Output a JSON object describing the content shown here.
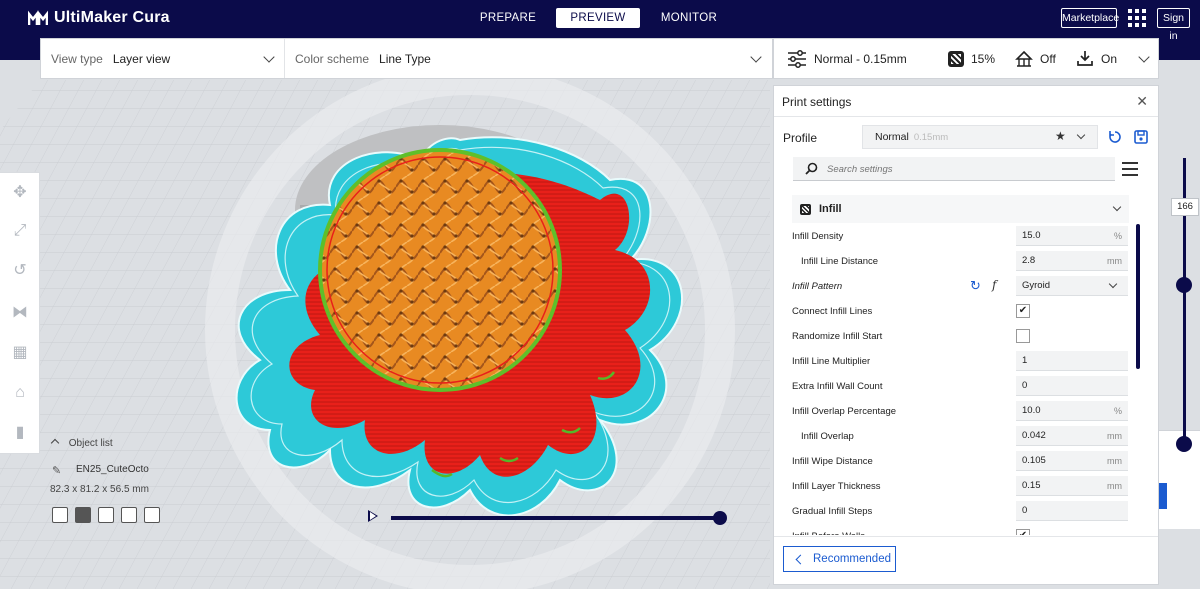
{
  "app": {
    "title": "UltiMaker Cura"
  },
  "stages": [
    {
      "label": "PREPARE",
      "active": false
    },
    {
      "label": "PREVIEW",
      "active": true
    },
    {
      "label": "MONITOR",
      "active": false
    }
  ],
  "header": {
    "marketplace_label": "Marketplace",
    "signin_label": "Sign in"
  },
  "view_toolbar": {
    "view_type_label": "View type",
    "view_type_value": "Layer view",
    "color_scheme_label": "Color scheme",
    "color_scheme_value": "Line Type"
  },
  "print_bar": {
    "profile_summary": "Normal - 0.15mm",
    "infill": "15%",
    "support": "Off",
    "adhesion": "On"
  },
  "print_settings": {
    "title": "Print settings",
    "profile_label": "Profile",
    "profile_name": "Normal",
    "profile_sub": "0.15mm",
    "search_placeholder": "Search settings",
    "category": "Infill",
    "settings": [
      {
        "label": "Infill Density",
        "value": "15.0",
        "unit": "%",
        "type": "field",
        "indent": false
      },
      {
        "label": "Infill Line Distance",
        "value": "2.8",
        "unit": "mm",
        "type": "field",
        "indent": true
      },
      {
        "label": "Infill Pattern",
        "value": "Gyroid",
        "unit": "",
        "type": "select",
        "indent": false,
        "italic": true
      },
      {
        "label": "Connect Infill Lines",
        "value": "✔",
        "type": "check",
        "checked": true,
        "indent": false
      },
      {
        "label": "Randomize Infill Start",
        "value": "",
        "type": "check",
        "checked": false,
        "indent": false
      },
      {
        "label": "Infill Line Multiplier",
        "value": "1",
        "unit": "",
        "type": "field",
        "indent": false
      },
      {
        "label": "Extra Infill Wall Count",
        "value": "0",
        "unit": "",
        "type": "field",
        "indent": false
      },
      {
        "label": "Infill Overlap Percentage",
        "value": "10.0",
        "unit": "%",
        "type": "field",
        "indent": false
      },
      {
        "label": "Infill Overlap",
        "value": "0.042",
        "unit": "mm",
        "type": "field",
        "indent": true
      },
      {
        "label": "Infill Wipe Distance",
        "value": "0.105",
        "unit": "mm",
        "type": "field",
        "indent": false
      },
      {
        "label": "Infill Layer Thickness",
        "value": "0.15",
        "unit": "mm",
        "type": "field",
        "indent": false
      },
      {
        "label": "Gradual Infill Steps",
        "value": "0",
        "unit": "",
        "type": "field",
        "indent": false
      },
      {
        "label": "Infill Before Walls",
        "value": "✔",
        "type": "check",
        "checked": true,
        "indent": false
      }
    ],
    "recommended_label": "Recommended"
  },
  "layer_slider": {
    "value": "166"
  },
  "object_list": {
    "heading": "Object list",
    "object_name": "EN25_CuteOcto",
    "dimensions": "82.3 x 81.2 x 56.5 mm"
  },
  "colors": {
    "header_bg": "#0b0b4a",
    "accent_blue": "#1b5bd0",
    "infill_orange": "#f0962e",
    "wall_red": "#e8201a",
    "skirt_cyan": "#28c8d8",
    "inner_wall_green": "#5fbf2a"
  },
  "icons": [
    "ultimaker-logo",
    "apps-grid-icon",
    "settings-sliders-icon",
    "infill-icon",
    "support-icon",
    "adhesion-icon",
    "search-icon",
    "menu-icon",
    "star-icon",
    "reset-icon",
    "save-icon",
    "function-icon",
    "chevron-left-icon",
    "play-icon"
  ]
}
